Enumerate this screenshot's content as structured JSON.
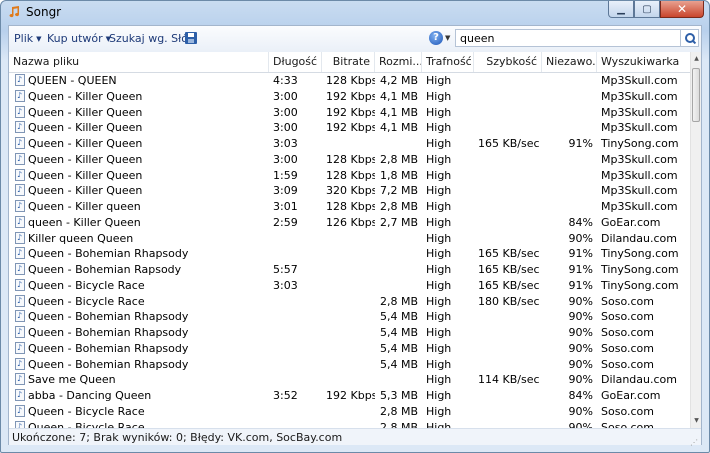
{
  "window": {
    "title": "Songr"
  },
  "toolbar": {
    "menu_file": "Plik",
    "menu_buy": "Kup utwór",
    "search_lyrics": "Szukaj wg. Słów",
    "search_value": "queen"
  },
  "table": {
    "headers": [
      "Nazwa pliku",
      "Długość",
      "Bitrate",
      "Rozmi...",
      "Trafność",
      "Szybkość",
      "Niezawo...",
      "Wyszukiwarka"
    ],
    "rows": [
      [
        "QUEEN - QUEEN",
        "4:33",
        "128 Kbps",
        "4,2 MB",
        "High",
        "",
        "",
        "Mp3Skull.com"
      ],
      [
        "Queen - Killer Queen",
        "3:00",
        "192 Kbps",
        "4,1 MB",
        "High",
        "",
        "",
        "Mp3Skull.com"
      ],
      [
        "Queen - Killer Queen",
        "3:00",
        "192 Kbps",
        "4,1 MB",
        "High",
        "",
        "",
        "Mp3Skull.com"
      ],
      [
        "Queen - Killer Queen",
        "3:00",
        "192 Kbps",
        "4,1 MB",
        "High",
        "",
        "",
        "Mp3Skull.com"
      ],
      [
        "Queen - Killer Queen",
        "3:03",
        "",
        "",
        "High",
        "165 KB/sec",
        "91%",
        "TinySong.com"
      ],
      [
        "Queen - Killer Queen",
        "3:00",
        "128 Kbps",
        "2,8 MB",
        "High",
        "",
        "",
        "Mp3Skull.com"
      ],
      [
        "Queen - Killer Queen",
        "1:59",
        "128 Kbps",
        "1,8 MB",
        "High",
        "",
        "",
        "Mp3Skull.com"
      ],
      [
        "Queen - Killer Queen",
        "3:09",
        "320 Kbps",
        "7,2 MB",
        "High",
        "",
        "",
        "Mp3Skull.com"
      ],
      [
        "Queen - Killer queen",
        "3:01",
        "128 Kbps",
        "2,8 MB",
        "High",
        "",
        "",
        "Mp3Skull.com"
      ],
      [
        "queen - Killer Queen",
        "2:59",
        "126 Kbps",
        "2,7 MB",
        "High",
        "",
        "84%",
        "GoEar.com"
      ],
      [
        "Killer queen Queen",
        "",
        "",
        "",
        "High",
        "",
        "90%",
        "Dilandau.com"
      ],
      [
        "Queen - Bohemian Rhapsody",
        "",
        "",
        "",
        "High",
        "165 KB/sec",
        "91%",
        "TinySong.com"
      ],
      [
        "Queen - Bohemian Rapsody",
        "5:57",
        "",
        "",
        "High",
        "165 KB/sec",
        "91%",
        "TinySong.com"
      ],
      [
        "Queen - Bicycle Race",
        "3:03",
        "",
        "",
        "High",
        "165 KB/sec",
        "91%",
        "TinySong.com"
      ],
      [
        "Queen - Bicycle Race",
        "",
        "",
        "2,8 MB",
        "High",
        "180 KB/sec",
        "90%",
        "Soso.com"
      ],
      [
        "Queen - Bohemian Rhapsody",
        "",
        "",
        "5,4 MB",
        "High",
        "",
        "90%",
        "Soso.com"
      ],
      [
        "Queen - Bohemian Rhapsody",
        "",
        "",
        "5,4 MB",
        "High",
        "",
        "90%",
        "Soso.com"
      ],
      [
        "Queen - Bohemian Rhapsody",
        "",
        "",
        "5,4 MB",
        "High",
        "",
        "90%",
        "Soso.com"
      ],
      [
        "Queen - Bohemian Rhapsody",
        "",
        "",
        "5,4 MB",
        "High",
        "",
        "90%",
        "Soso.com"
      ],
      [
        "Save me Queen",
        "",
        "",
        "",
        "High",
        "114 KB/sec",
        "90%",
        "Dilandau.com"
      ],
      [
        "abba - Dancing Queen",
        "3:52",
        "192 Kbps",
        "5,3 MB",
        "High",
        "",
        "84%",
        "GoEar.com"
      ],
      [
        "Queen - Bicycle Race",
        "",
        "",
        "2,8 MB",
        "High",
        "",
        "90%",
        "Soso.com"
      ],
      [
        "Queen - Bicycle Race",
        "",
        "",
        "2,8 MB",
        "High",
        "",
        "90%",
        "Soso.com"
      ]
    ]
  },
  "status": {
    "text": "Ukończone: 7; Brak wyników: 0; Błędy: VK.com, SocBay.com"
  }
}
